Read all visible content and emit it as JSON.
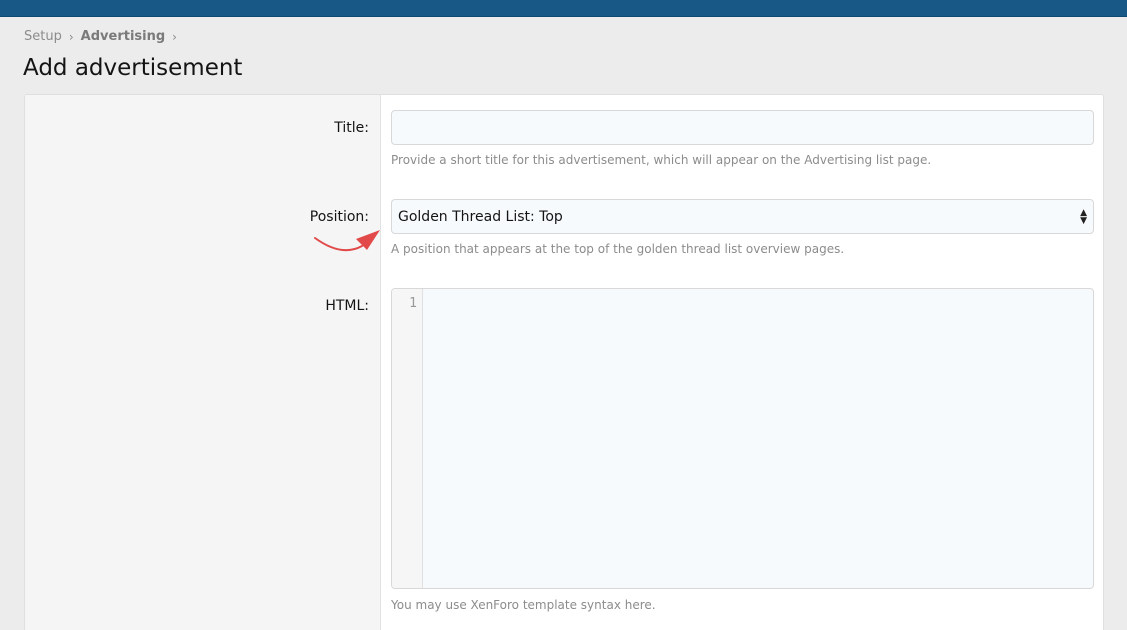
{
  "breadcrumb": {
    "items": [
      "Setup",
      "Advertising"
    ],
    "separator": "›"
  },
  "page": {
    "title": "Add advertisement"
  },
  "form": {
    "title": {
      "label": "Title:",
      "value": "",
      "hint": "Provide a short title for this advertisement, which will appear on the Advertising list page."
    },
    "position": {
      "label": "Position:",
      "selected": "Golden Thread List: Top",
      "hint": "A position that appears at the top of the golden thread list overview pages."
    },
    "html": {
      "label": "HTML:",
      "line_number": "1",
      "value": "",
      "hint": "You may use XenForo template syntax here."
    }
  },
  "colors": {
    "header": "#185886",
    "annotation_arrow": "#e24a4a"
  }
}
